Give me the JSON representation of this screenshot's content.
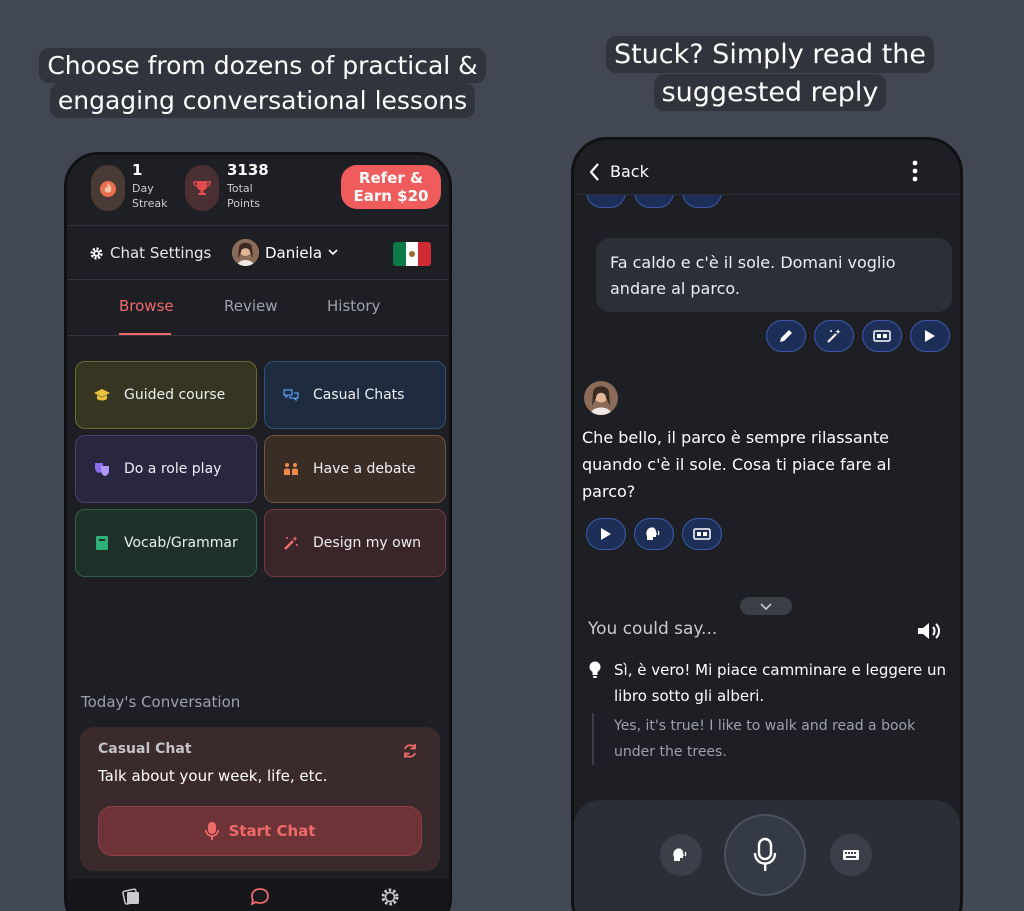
{
  "captions": {
    "left": "Choose from dozens of practical & engaging conversational lessons",
    "right": "Stuck? Simply read the suggested reply"
  },
  "left_phone": {
    "stats": {
      "streak_value": "1",
      "streak_label_1": "Day",
      "streak_label_2": "Streak",
      "points_value": "3138",
      "points_label_1": "Total",
      "points_label_2": "Points",
      "refer_line1": "Refer &",
      "refer_line2": "Earn $20"
    },
    "settings": {
      "chat_settings_label": "Chat Settings",
      "tutor_name": "Daniela"
    },
    "tabs": [
      "Browse",
      "Review",
      "History"
    ],
    "active_tab": "Browse",
    "cards": [
      {
        "label": "Guided course",
        "icon": "graduation-cap-icon"
      },
      {
        "label": "Casual Chats",
        "icon": "chat-bubbles-icon"
      },
      {
        "label": "Do a role play",
        "icon": "theater-masks-icon"
      },
      {
        "label": "Have a debate",
        "icon": "people-debate-icon"
      },
      {
        "label": "Vocab/Grammar",
        "icon": "book-icon"
      },
      {
        "label": "Design my own",
        "icon": "magic-wand-icon"
      }
    ],
    "today": {
      "section_label": "Today's Conversation",
      "card_title": "Casual Chat",
      "card_subtitle": "Talk about your week, life, etc.",
      "start_label": "Start Chat"
    },
    "colors": {
      "accent": "#f06a6a",
      "refer_bg": "#f05c5c"
    }
  },
  "right_phone": {
    "back_label": "Back",
    "user_message": "Fa caldo e c'è il sole. Domani voglio andare al parco.",
    "ai_message": "Che bello, il parco è sempre rilassante quando c'è il sole. Cosa ti piace fare al parco?",
    "you_could_say": "You could say...",
    "suggestion": "Sì, è vero! Mi piace camminare e leggere un libro sotto gli alberi.",
    "translation": "Yes, it's true! I like to walk and read a book under the trees.",
    "colors": {
      "pill_bg": "#1e2f57",
      "pill_border": "#3b5ba8"
    }
  }
}
